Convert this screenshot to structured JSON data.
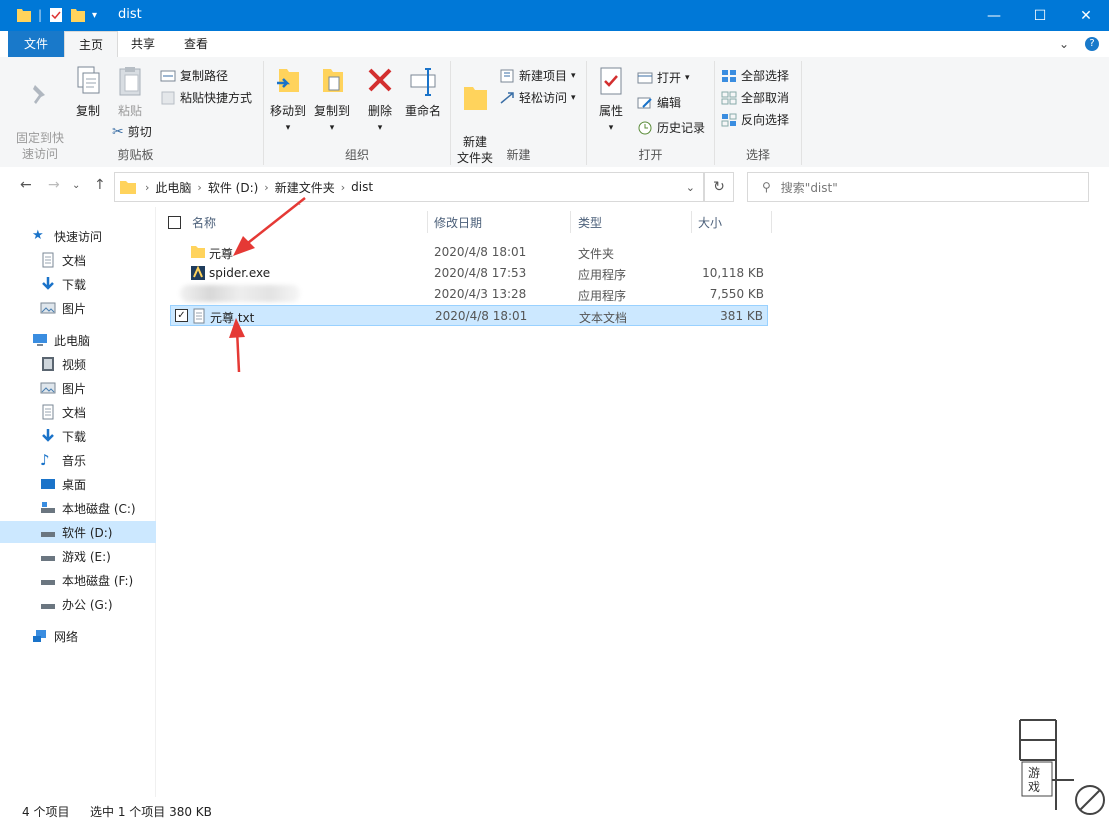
{
  "window": {
    "title": "dist",
    "buttons": [
      "—",
      "☐",
      "✕"
    ]
  },
  "ribbon_tabs": {
    "file": "文件",
    "home": "主页",
    "share": "共享",
    "view": "查看"
  },
  "ribbon": {
    "clipboard": {
      "label": "剪贴板",
      "pin": "固定到快\n速访问",
      "copy": "复制",
      "paste": "粘贴",
      "copy_path": "复制路径",
      "paste_shortcut": "粘贴快捷方式",
      "cut": "剪切"
    },
    "organize": {
      "label": "组织",
      "move_to": "移动到",
      "copy_to": "复制到",
      "delete": "删除",
      "rename": "重命名"
    },
    "new": {
      "label": "新建",
      "new_folder": "新建\n文件夹",
      "new_item": "新建项目",
      "easy_access": "轻松访问"
    },
    "open": {
      "label": "打开",
      "properties": "属性",
      "open": "打开",
      "edit": "编辑",
      "history": "历史记录"
    },
    "select": {
      "label": "选择",
      "select_all": "全部选择",
      "select_none": "全部取消",
      "invert": "反向选择"
    }
  },
  "address": {
    "crumbs": [
      "此电脑",
      "软件 (D:)",
      "新建文件夹",
      "dist"
    ],
    "search_placeholder": "搜索\"dist\""
  },
  "nav": {
    "quick_access": "快速访问",
    "qa_docs": "文档",
    "qa_downloads": "下载",
    "qa_pictures": "图片",
    "this_pc": "此电脑",
    "videos": "视频",
    "pictures": "图片",
    "docs": "文档",
    "downloads": "下载",
    "music": "音乐",
    "desktop": "桌面",
    "drive_c": "本地磁盘 (C:)",
    "drive_d": "软件 (D:)",
    "drive_e": "游戏 (E:)",
    "drive_f": "本地磁盘 (F:)",
    "drive_g": "办公 (G:)",
    "network": "网络"
  },
  "columns": {
    "name": "名称",
    "modified": "修改日期",
    "type": "类型",
    "size": "大小"
  },
  "files": [
    {
      "name": "元尊",
      "modified": "2020/4/8 18:01",
      "type": "文件夹",
      "size": ""
    },
    {
      "name": "spider.exe",
      "modified": "2020/4/8 17:53",
      "type": "应用程序",
      "size": "10,118 KB"
    },
    {
      "name": "",
      "modified": "2020/4/3 13:28",
      "type": "应用程序",
      "size": "7,550 KB"
    },
    {
      "name": "元尊.txt",
      "modified": "2020/4/8 18:01",
      "type": "文本文档",
      "size": "381 KB"
    }
  ],
  "status": {
    "count": "4 个项目",
    "selected": "选中 1 个项目  380 KB"
  },
  "watermark": {
    "text": "游戏"
  }
}
